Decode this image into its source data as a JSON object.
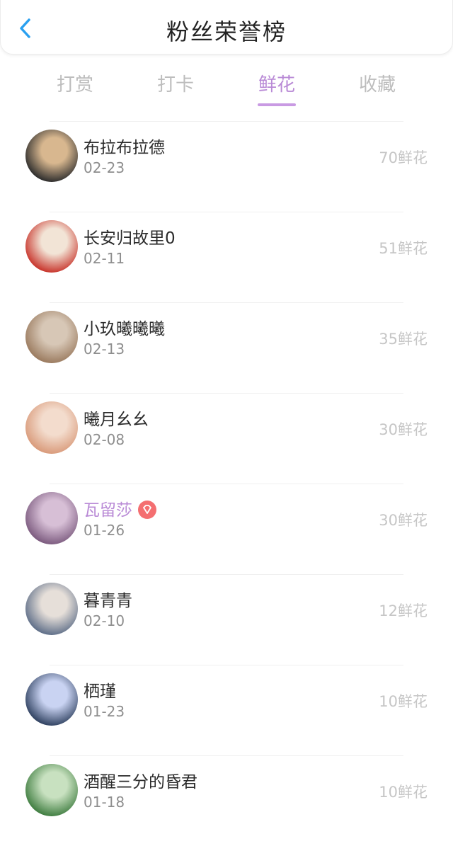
{
  "header": {
    "title": "粉丝荣誉榜"
  },
  "tabs": [
    {
      "label": "打赏",
      "active": false
    },
    {
      "label": "打卡",
      "active": false
    },
    {
      "label": "鲜花",
      "active": true
    },
    {
      "label": "收藏",
      "active": false
    }
  ],
  "colors": {
    "accent": "#b98ad6",
    "amount": "#c6c6c6",
    "badge": "#f46f71"
  },
  "fans": [
    {
      "name": "布拉布拉德",
      "date": "02-23",
      "amount": "70鲜花",
      "vip": false,
      "avatar_colors": [
        "#2c2c2c",
        "#d8b78f"
      ]
    },
    {
      "name": "长安归故里0",
      "date": "02-11",
      "amount": "51鲜花",
      "vip": false,
      "avatar_colors": [
        "#c8342b",
        "#f2e4d6"
      ]
    },
    {
      "name": "小玖曦曦曦",
      "date": "02-13",
      "amount": "35鲜花",
      "vip": false,
      "avatar_colors": [
        "#9a7a5e",
        "#d7c7b6"
      ]
    },
    {
      "name": "曦月幺幺",
      "date": "02-08",
      "amount": "30鲜花",
      "vip": false,
      "avatar_colors": [
        "#d99a7a",
        "#f3dccd"
      ]
    },
    {
      "name": "瓦留莎",
      "date": "01-26",
      "amount": "30鲜花",
      "vip": true,
      "avatar_colors": [
        "#7b5a7e",
        "#d7bfd6"
      ]
    },
    {
      "name": "暮青青",
      "date": "02-10",
      "amount": "12鲜花",
      "vip": false,
      "avatar_colors": [
        "#5e6e88",
        "#e6dfd9"
      ]
    },
    {
      "name": "栖瑾",
      "date": "01-23",
      "amount": "10鲜花",
      "vip": false,
      "avatar_colors": [
        "#2f4160",
        "#c9d3f2"
      ]
    },
    {
      "name": "酒醒三分的昏君",
      "date": "01-18",
      "amount": "10鲜花",
      "vip": false,
      "avatar_colors": [
        "#3f7d40",
        "#c8e1c0"
      ]
    }
  ]
}
